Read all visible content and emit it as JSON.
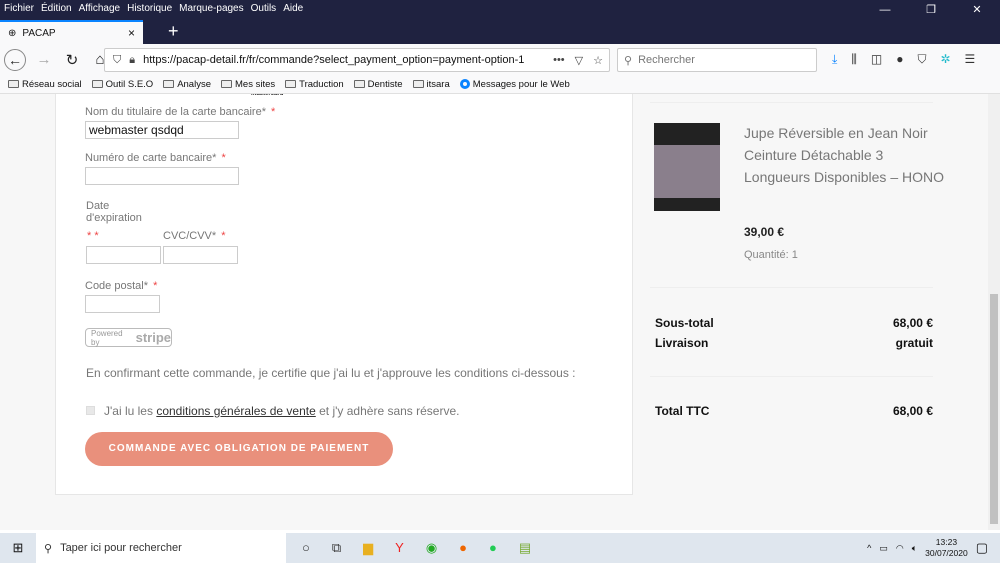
{
  "colors": {
    "titlebar": "#1f2240",
    "accent": "#0a84ff",
    "order_button": "#e9907c",
    "required": "#e44444"
  },
  "menu": [
    "Fichier",
    "Édition",
    "Affichage",
    "Historique",
    "Marque-pages",
    "Outils",
    "Aide"
  ],
  "window_controls": {
    "minimize": "—",
    "maximize": "❐",
    "close": "✕"
  },
  "tab": {
    "title": "PACAP",
    "close": "×",
    "new": "+"
  },
  "toolbar": {
    "url": "https://pacap-detail.fr/fr/commande?select_payment_option=payment-option-1",
    "search_placeholder": "Rechercher"
  },
  "bookmarks": [
    "Réseau social",
    "Outil S.E.O",
    "Analyse",
    "Mes sites",
    "Traduction",
    "Dentiste",
    "itsara",
    "Messages pour le Web"
  ],
  "form": {
    "card_brand": "mastercard",
    "holder_label": "Nom du titulaire de la carte bancaire*",
    "holder_value": "webmaster qsdqd",
    "number_label": "Numéro de carte bancaire*",
    "expiry_label_1": "Date",
    "expiry_label_2": "d'expiration",
    "cvc_label": "CVC/CVV*",
    "postal_label": "Code postal*",
    "required_mark": "*",
    "powered_by": "Powered by",
    "stripe": "stripe",
    "confirm_text": "En confirmant cette commande, je certifie que j'ai lu et j'approuve les conditions ci-dessous :",
    "cgv_prefix": "J'ai lu les",
    "cgv_link": "conditions générales de vente",
    "cgv_suffix": "et j'y adhère sans réserve.",
    "cgv_checked": false,
    "order_button": "COMMANDE AVEC OBLIGATION DE PAIEMENT"
  },
  "summary": {
    "product_name": "Jupe Réversible en Jean Noir Ceinture Détachable 3 Longueurs Disponibles – HONO",
    "product_price": "39,00 €",
    "quantity": "Quantité: 1",
    "subtotal_label": "Sous-total",
    "subtotal": "68,00 €",
    "shipping_label": "Livraison",
    "shipping": "gratuit",
    "total_label": "Total TTC",
    "total": "68,00 €"
  },
  "taskbar": {
    "search": "Taper ici pour rechercher",
    "time": "13:23",
    "date": "30/07/2020"
  }
}
